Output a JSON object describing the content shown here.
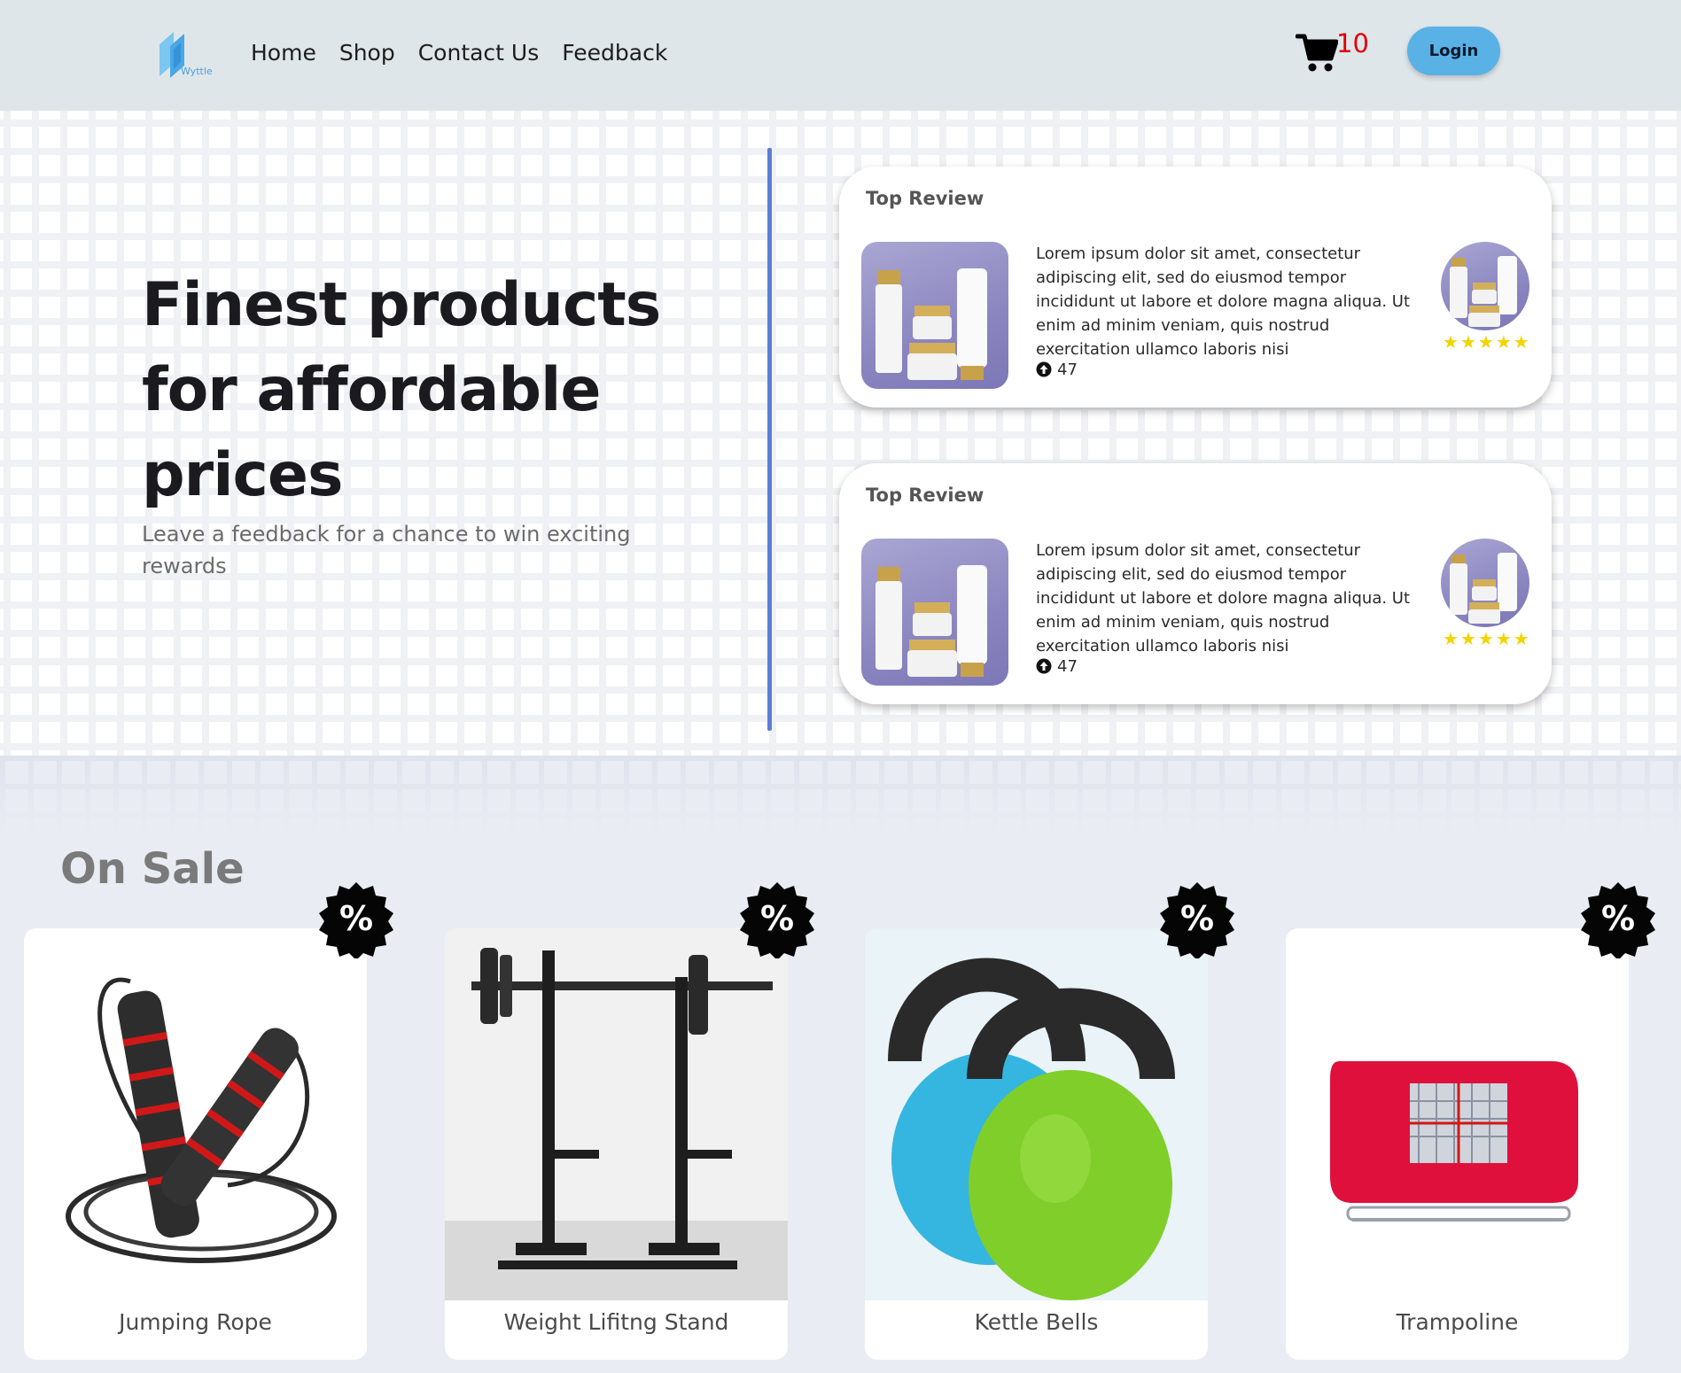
{
  "navbar": {
    "logo_text": "Wyttle",
    "links": [
      "Home",
      "Shop",
      "Contact Us",
      "Feedback"
    ],
    "cart_count": "10",
    "login_label": "Login"
  },
  "hero": {
    "title": "Finest products for affordable prices",
    "subtitle": "Leave a feedback for a chance to win exciting rewards"
  },
  "reviews": [
    {
      "heading": "Top Review",
      "text": "Lorem ipsum dolor sit amet, consectetur adipiscing elit, sed do eiusmod tempor incididunt ut labore et dolore magna aliqua. Ut enim ad minim veniam, quis nostrud exercitation ullamco laboris nisi",
      "votes": "47",
      "rating": 5
    },
    {
      "heading": "Top Review",
      "text": "Lorem ipsum dolor sit amet, consectetur adipiscing elit, sed do eiusmod tempor incididunt ut labore et dolore magna aliqua. Ut enim ad minim veniam, quis nostrud exercitation ullamco laboris nisi",
      "votes": "47",
      "rating": 5
    }
  ],
  "sale": {
    "title": "On Sale",
    "badge_symbol": "%",
    "products": [
      {
        "name": "Jumping Rope",
        "icon": "jump-rope"
      },
      {
        "name": "Weight Lifitng Stand",
        "icon": "weight-stand"
      },
      {
        "name": "Kettle Bells",
        "icon": "kettlebells"
      },
      {
        "name": "Trampoline",
        "icon": "trampoline"
      }
    ]
  },
  "colors": {
    "navbar_bg": "#dfe6ea",
    "login_bg": "#5ab1e6",
    "cart_count": "#e00000",
    "divider": "#5b7fd6",
    "star": "#f2d400"
  }
}
